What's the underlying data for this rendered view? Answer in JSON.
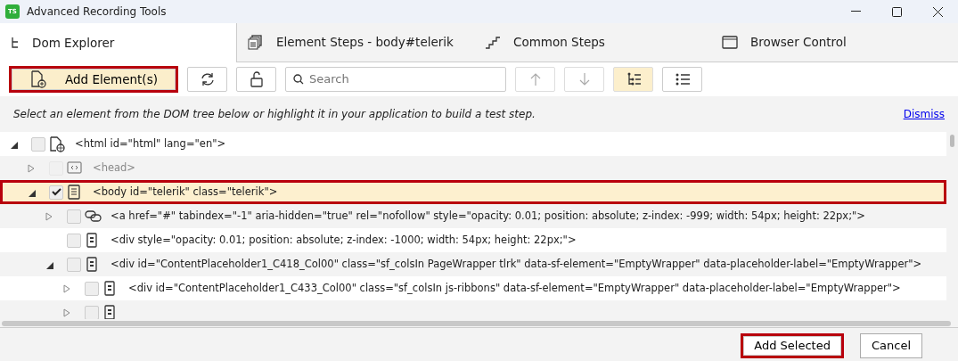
{
  "window": {
    "title": "Advanced Recording Tools",
    "app_badge": "TS"
  },
  "tabs": [
    {
      "label": "Dom Explorer",
      "kind": "tree",
      "selected": true
    },
    {
      "label": "Element Steps - body#telerik",
      "kind": "stack",
      "selected": false
    },
    {
      "label": "Common Steps",
      "kind": "steps",
      "selected": false
    },
    {
      "label": "Browser Control",
      "kind": "browser",
      "selected": false
    }
  ],
  "toolbar": {
    "add_button": {
      "label": "Add Element(s)",
      "highlighted": true
    },
    "search": {
      "placeholder": "Search"
    },
    "buttons": [
      {
        "kind": "refresh",
        "disabled": false,
        "selected": false
      },
      {
        "kind": "unlock",
        "disabled": false,
        "selected": false
      },
      {
        "kind": "search"
      },
      {
        "kind": "up",
        "disabled": true,
        "selected": false
      },
      {
        "kind": "down",
        "disabled": true,
        "selected": false
      },
      {
        "kind": "tree-view",
        "disabled": false,
        "selected": true
      },
      {
        "kind": "list-view",
        "disabled": false,
        "selected": false
      }
    ]
  },
  "info": {
    "text": "Select an element from the DOM tree below or highlight it in your application to build a test step.",
    "link": "Dismiss"
  },
  "tree": [
    {
      "label": "<html id=\"html\" lang=\"en\">",
      "kind": "page",
      "expanded": true,
      "checked": false,
      "disabled": false,
      "selected": false,
      "children": [
        {
          "label": "<head>",
          "kind": "code",
          "expanded": false,
          "checked": false,
          "disabled": true,
          "selected": false
        },
        {
          "label": "<body id=\"telerik\" class=\"telerik\">",
          "kind": "document",
          "expanded": true,
          "checked": true,
          "disabled": false,
          "selected": true,
          "highlighted": true,
          "children": [
            {
              "label": "<a href=\"#\" tabindex=\"-1\" aria-hidden=\"true\" rel=\"nofollow\" style=\"opacity: 0.01; position: absolute; z-index: -999; width: 54px; height: 22px;\">",
              "kind": "link",
              "expanded": false,
              "checked": false,
              "disabled": false,
              "selected": false
            },
            {
              "label": "<div style=\"opacity: 0.01; position: absolute; z-index: -1000; width: 54px; height: 22px;\">",
              "kind": "element",
              "checked": false,
              "disabled": false,
              "selected": false
            },
            {
              "label": "<div id=\"ContentPlaceholder1_C418_Col00\" class=\"sf_colsIn PageWrapper tlrk\" data-sf-element=\"EmptyWrapper\" data-placeholder-label=\"EmptyWrapper\">",
              "kind": "element",
              "expanded": true,
              "checked": false,
              "disabled": false,
              "selected": false,
              "children": [
                {
                  "label": "<div id=\"ContentPlaceholder1_C433_Col00\" class=\"sf_colsIn js-ribbons\" data-sf-element=\"EmptyWrapper\" data-placeholder-label=\"EmptyWrapper\">",
                  "kind": "element",
                  "expanded": false,
                  "checked": false,
                  "disabled": false,
                  "selected": false
                },
                {
                  "kind": "element",
                  "expanded": false,
                  "checked": false,
                  "disabled": false,
                  "selected": false
                }
              ]
            }
          ]
        }
      ]
    }
  ],
  "footer": {
    "buttons": [
      {
        "label": "Add Selected",
        "highlighted": true
      },
      {
        "label": "Cancel",
        "highlighted": false
      }
    ]
  }
}
